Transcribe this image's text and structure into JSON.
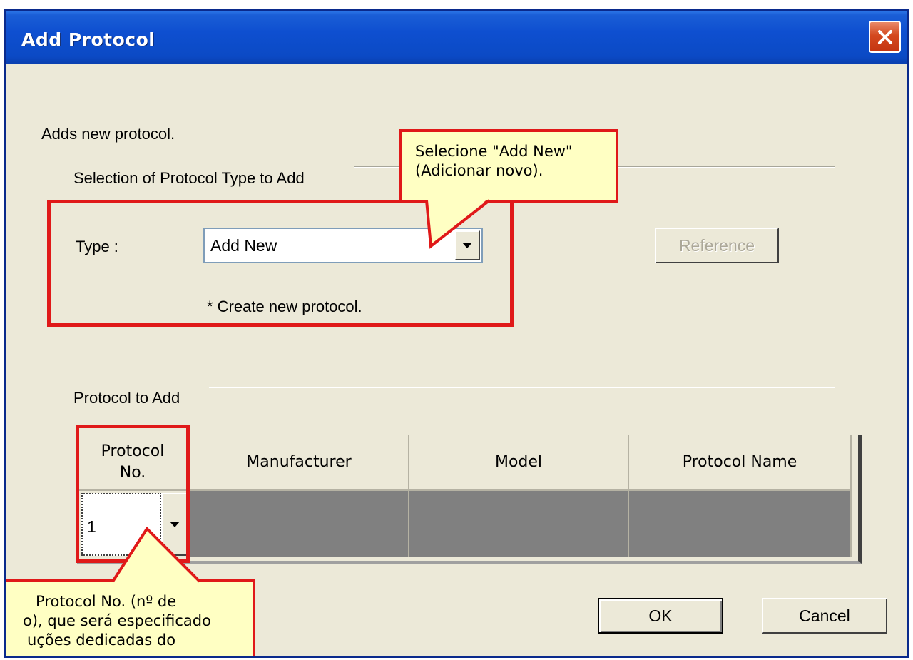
{
  "window": {
    "title": "Add Protocol",
    "description": "Adds new protocol."
  },
  "selection_group": {
    "label": "Selection of Protocol Type to Add",
    "type_label": "Type :",
    "type_value": "Add New",
    "hint": "* Create new protocol.",
    "reference_button": "Reference"
  },
  "protocol_group": {
    "label": "Protocol to Add",
    "columns": [
      "Protocol No.",
      "Manufacturer",
      "Model",
      "Protocol Name"
    ],
    "row": {
      "protocol_no": "1",
      "manufacturer": "",
      "model": "",
      "protocol_name": ""
    }
  },
  "buttons": {
    "ok": "OK",
    "cancel": "Cancel"
  },
  "callouts": {
    "top_line1": "Selecione \"Add New\"",
    "top_line2": "(Adicionar novo).",
    "bottom_line1": "Protocol No. (nº de",
    "bottom_line2": "o), que será especificado",
    "bottom_line3": "uções dedicadas do"
  },
  "colors": {
    "title_bar": "#0b4ac5",
    "dialog_bg": "#ece9d8",
    "highlight_red": "#e01919",
    "callout_fill": "#ffffc3",
    "grid_cell": "#808080"
  },
  "icons": {
    "close": "close-icon",
    "dropdown": "chevron-down-icon"
  }
}
